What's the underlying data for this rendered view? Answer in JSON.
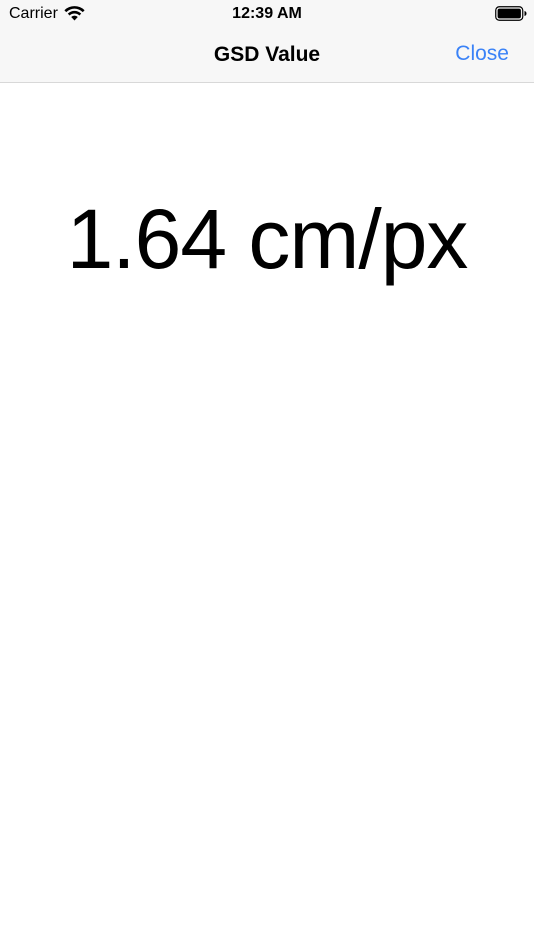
{
  "status_bar": {
    "carrier": "Carrier",
    "time": "12:39 AM",
    "wifi_icon": "wifi-icon",
    "battery_icon": "battery-full-icon"
  },
  "nav": {
    "title": "GSD Value",
    "close_label": "Close",
    "accent_color": "#3a82f7"
  },
  "main": {
    "gsd_value": "1.64 cm/px"
  }
}
